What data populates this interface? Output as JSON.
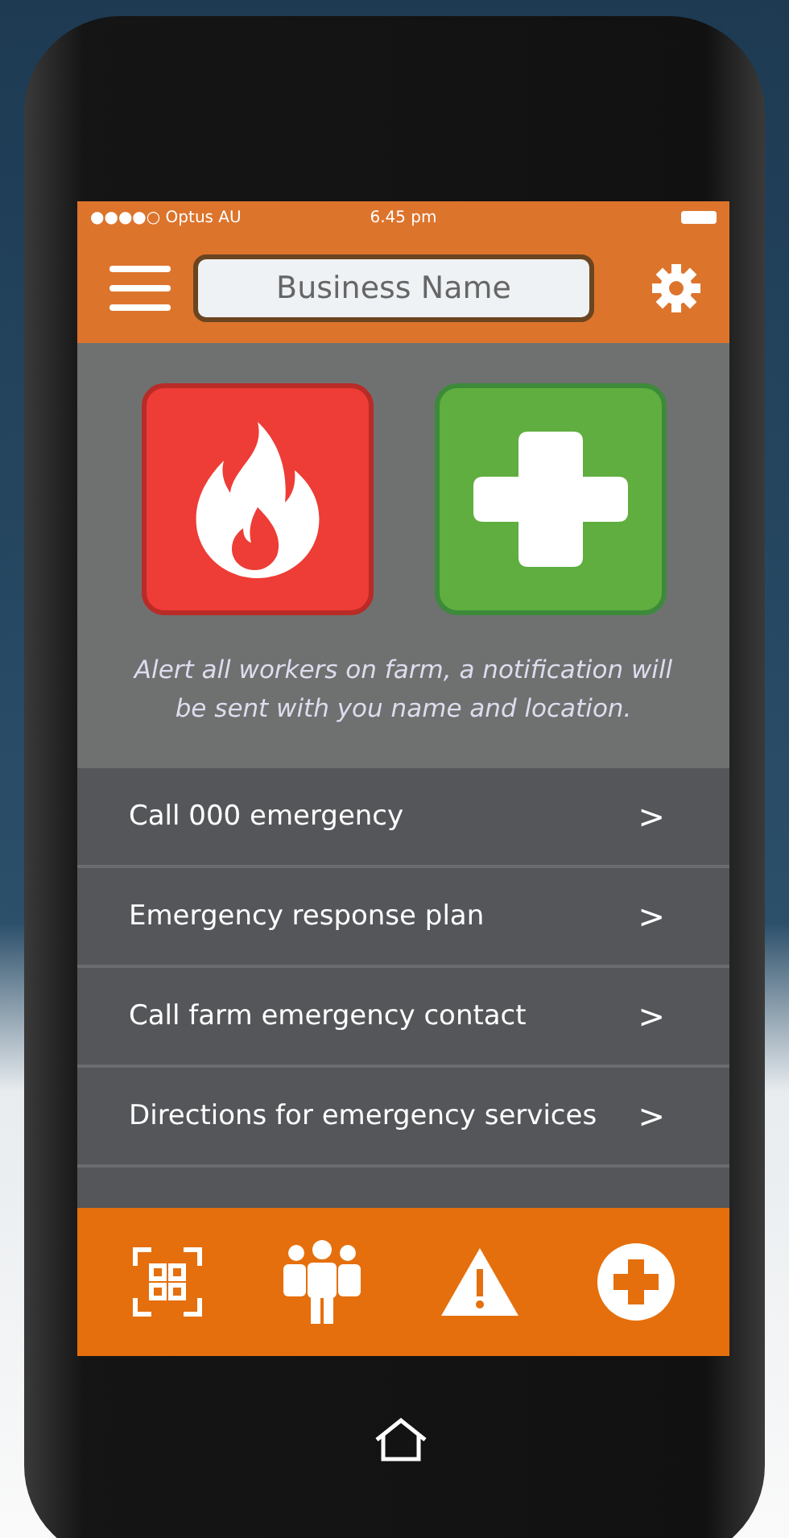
{
  "status_bar": {
    "carrier": "●●●●○ Optus AU",
    "time": "6.45 pm"
  },
  "header": {
    "title": "Business Name"
  },
  "alert_buttons": [
    {
      "kind": "fire"
    },
    {
      "kind": "first-aid"
    }
  ],
  "alert_note": "Alert all workers on farm, a notification will be sent with you name and location.",
  "menu_items": [
    {
      "label": "Call 000 emergency",
      "chevron": ">"
    },
    {
      "label": "Emergency response plan",
      "chevron": ">"
    },
    {
      "label": "Call farm emergency contact",
      "chevron": ">"
    },
    {
      "label": "Directions for emergency services",
      "chevron": ">"
    }
  ],
  "tab_bar": [
    {
      "kind": "qr"
    },
    {
      "kind": "people"
    },
    {
      "kind": "warning"
    },
    {
      "kind": "first-aid"
    }
  ]
}
